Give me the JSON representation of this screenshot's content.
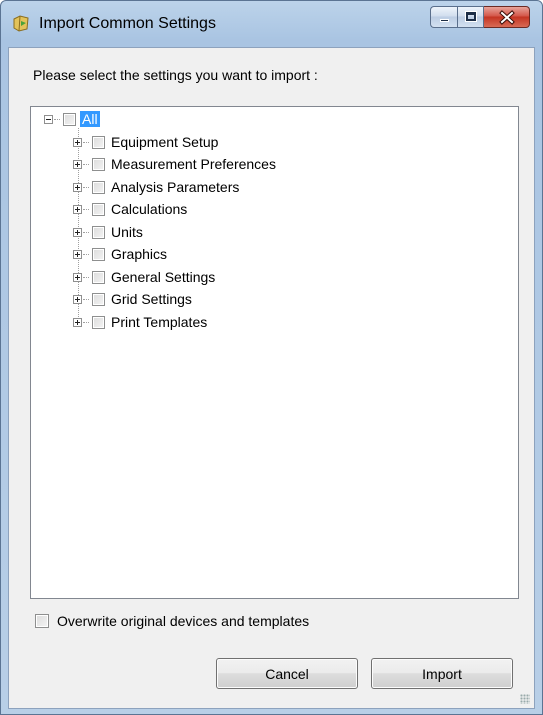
{
  "window": {
    "title": "Import Common Settings",
    "icon": "import-settings-icon"
  },
  "prompt": "Please select the settings you want to import :",
  "tree": {
    "root": {
      "label": "All",
      "checked": false,
      "expanded": true,
      "selected": true
    },
    "items": [
      {
        "label": "Equipment Setup",
        "checked": false
      },
      {
        "label": "Measurement Preferences",
        "checked": false
      },
      {
        "label": "Analysis Parameters",
        "checked": false
      },
      {
        "label": "Calculations",
        "checked": false
      },
      {
        "label": "Units",
        "checked": false
      },
      {
        "label": "Graphics",
        "checked": false
      },
      {
        "label": "General Settings",
        "checked": false
      },
      {
        "label": "Grid Settings",
        "checked": false
      },
      {
        "label": "Print Templates",
        "checked": false
      }
    ]
  },
  "overwrite": {
    "label": "Overwrite original devices and templates",
    "checked": false
  },
  "buttons": {
    "cancel": "Cancel",
    "import": "Import"
  },
  "colors": {
    "selection": "#3399ff",
    "close_button": "#c43422"
  }
}
